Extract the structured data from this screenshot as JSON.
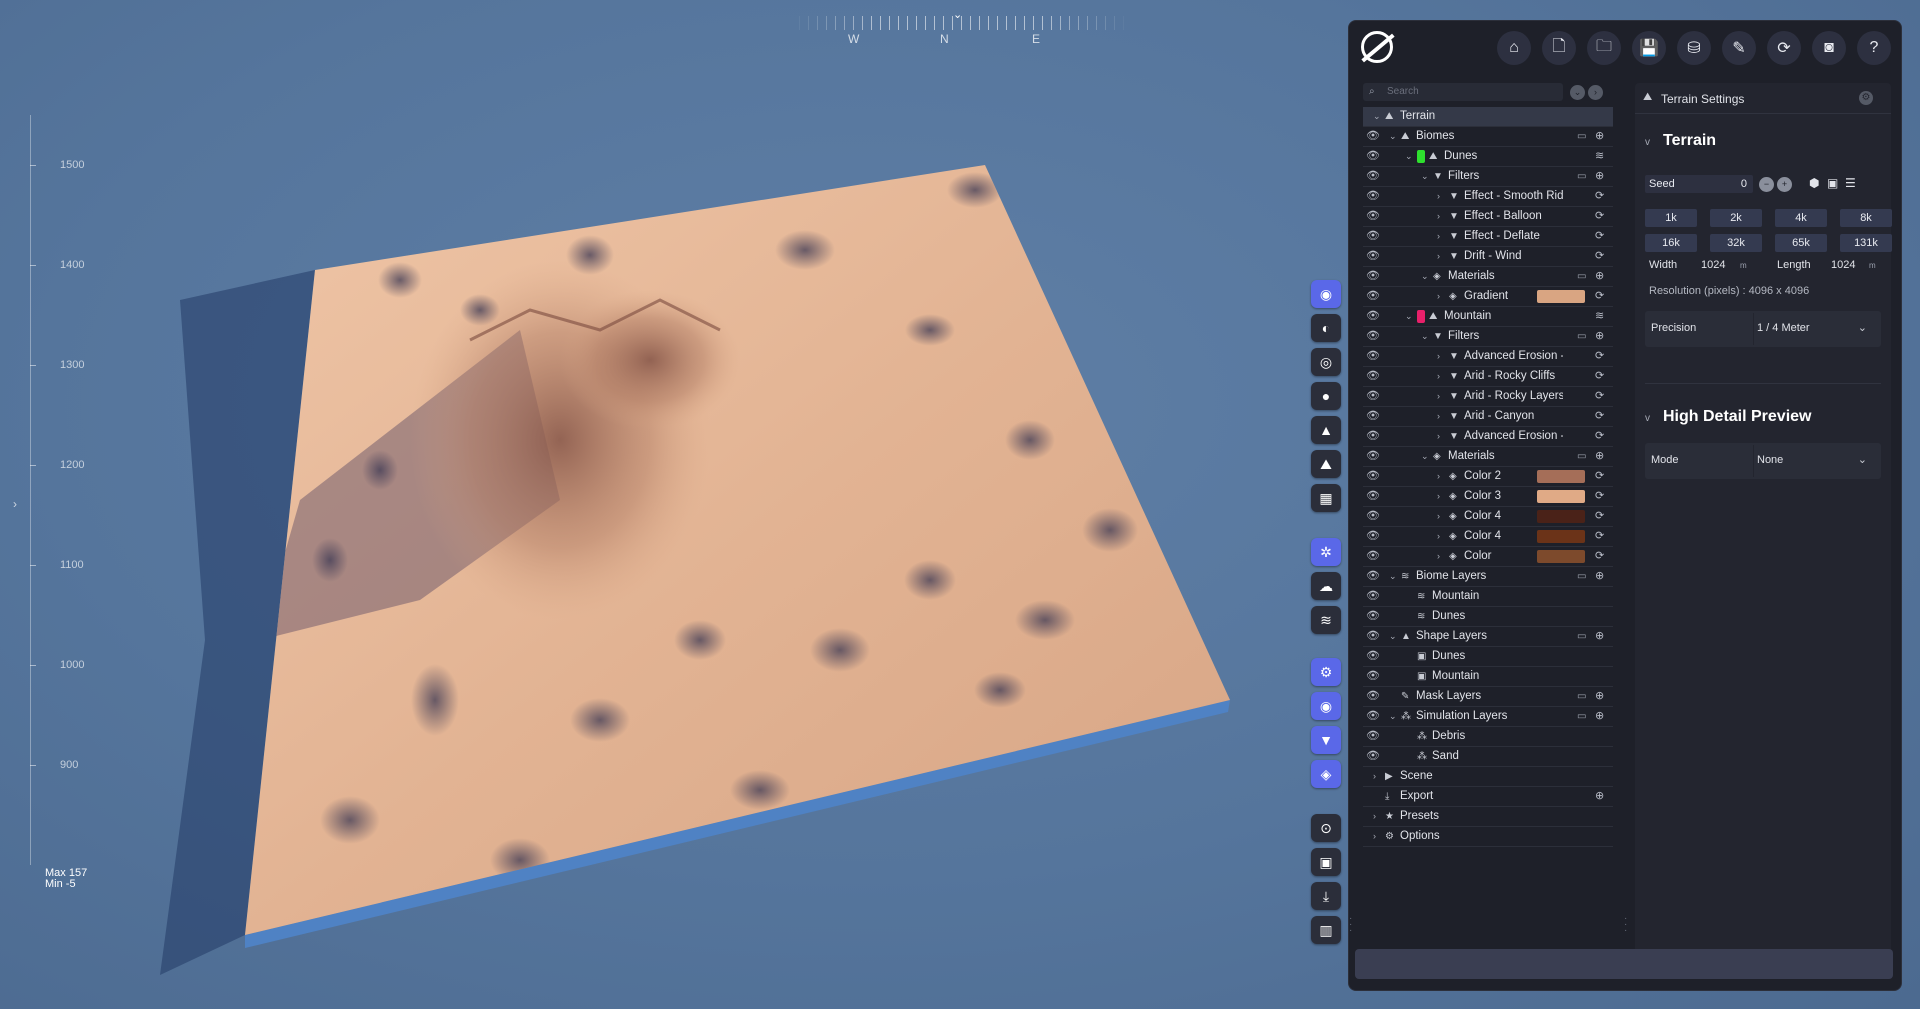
{
  "viewport": {
    "compass": [
      "W",
      "N",
      "E"
    ],
    "ruler_marks": [
      "1500",
      "1400",
      "1300",
      "1200",
      "1100",
      "1000",
      "900"
    ],
    "max_label": "Max 157",
    "min_label": "Min -5",
    "colors": {
      "sand": "#e4b898",
      "sky": "#55759c",
      "base": "#4f82c4"
    }
  },
  "toolbar": {
    "buttons": [
      {
        "name": "home-button",
        "icon": "⌂"
      },
      {
        "name": "new-file-button",
        "icon": "🗋"
      },
      {
        "name": "open-folder-button",
        "icon": "🗀"
      },
      {
        "name": "save-button",
        "icon": "💾"
      },
      {
        "name": "save-as-button",
        "icon": "⛁"
      },
      {
        "name": "edit-button",
        "icon": "✎"
      },
      {
        "name": "refresh-button",
        "icon": "⟳"
      },
      {
        "name": "screenshot-button",
        "icon": "◙"
      },
      {
        "name": "help-button",
        "icon": "?"
      }
    ]
  },
  "tools": [
    {
      "icon": "◉",
      "blue": true
    },
    {
      "icon": "◐",
      "blue": false
    },
    {
      "icon": "◎",
      "blue": false
    },
    {
      "icon": "●",
      "blue": false
    },
    {
      "icon": "▲",
      "blue": false
    },
    {
      "icon": "⛰",
      "blue": false
    },
    {
      "icon": "▦",
      "blue": false
    },
    {
      "icon": "✲",
      "blue": true
    },
    {
      "icon": "☁",
      "blue": false
    },
    {
      "icon": "≋",
      "blue": false
    },
    {
      "icon": "⚙",
      "blue": true
    },
    {
      "icon": "◉",
      "blue": true
    },
    {
      "icon": "▼",
      "blue": true
    },
    {
      "icon": "◈",
      "blue": true
    },
    {
      "icon": "⊙",
      "blue": false
    },
    {
      "icon": "▣",
      "blue": false
    },
    {
      "icon": "⤓",
      "blue": false
    },
    {
      "icon": "▥",
      "blue": false
    }
  ],
  "tree": {
    "search_placeholder": "Search",
    "rows": [
      {
        "label": "Terrain",
        "depth": 0,
        "chev": "v",
        "icon": "⛰",
        "eye": false,
        "sel": true
      },
      {
        "label": "Biomes",
        "depth": 1,
        "chev": "v",
        "icon": "⛰",
        "eye": true,
        "r1": "▭",
        "r2": "⊕"
      },
      {
        "label": "Dunes",
        "depth": 2,
        "chev": "v",
        "icon": "⛰",
        "eye": true,
        "tag": "#2ee02e",
        "r2": "≋"
      },
      {
        "label": "Filters",
        "depth": 3,
        "chev": "v",
        "icon": "▼",
        "eye": true,
        "r1": "▭",
        "r2": "⊕"
      },
      {
        "label": "Effect - Smooth Ridge",
        "depth": 4,
        "chev": ">",
        "icon": "▼",
        "eye": true,
        "r2": "⟳"
      },
      {
        "label": "Effect - Balloon",
        "depth": 4,
        "chev": ">",
        "icon": "▼",
        "eye": true,
        "r2": "⟳"
      },
      {
        "label": "Effect - Deflate",
        "depth": 4,
        "chev": ">",
        "icon": "▼",
        "eye": true,
        "r2": "⟳"
      },
      {
        "label": "Drift - Wind",
        "depth": 4,
        "chev": ">",
        "icon": "▼",
        "eye": true,
        "r2": "⟳"
      },
      {
        "label": "Materials",
        "depth": 3,
        "chev": "v",
        "icon": "◈",
        "eye": true,
        "r1": "▭",
        "r2": "⊕"
      },
      {
        "label": "Gradient",
        "depth": 4,
        "chev": ">",
        "icon": "◈",
        "eye": true,
        "swatch": "#d9a582",
        "r2": "⟳"
      },
      {
        "label": "Mountain",
        "depth": 2,
        "chev": "v",
        "icon": "⛰",
        "eye": true,
        "tag": "#e8206a",
        "r2": "≋"
      },
      {
        "label": "Filters",
        "depth": 3,
        "chev": "v",
        "icon": "▼",
        "eye": true,
        "r1": "▭",
        "r2": "⊕"
      },
      {
        "label": "Advanced Erosion - W",
        "depth": 4,
        "chev": ">",
        "icon": "▼",
        "eye": true,
        "r2": "⟳"
      },
      {
        "label": "Arid - Rocky Cliffs",
        "depth": 4,
        "chev": ">",
        "icon": "▼",
        "eye": true,
        "r2": "⟳"
      },
      {
        "label": "Arid - Rocky Layers",
        "depth": 4,
        "chev": ">",
        "icon": "▼",
        "eye": true,
        "r2": "⟳"
      },
      {
        "label": "Arid - Canyon",
        "depth": 4,
        "chev": ">",
        "icon": "▼",
        "eye": true,
        "r2": "⟳"
      },
      {
        "label": "Advanced Erosion - Sr",
        "depth": 4,
        "chev": ">",
        "icon": "▼",
        "eye": true,
        "r2": "⟳"
      },
      {
        "label": "Materials",
        "depth": 3,
        "chev": "v",
        "icon": "◈",
        "eye": true,
        "r1": "▭",
        "r2": "⊕"
      },
      {
        "label": "Color 2",
        "depth": 4,
        "chev": ">",
        "icon": "◈",
        "eye": true,
        "swatch": "#a56e58",
        "r2": "⟳"
      },
      {
        "label": "Color 3",
        "depth": 4,
        "chev": ">",
        "icon": "◈",
        "eye": true,
        "swatch": "#e0aa86",
        "r2": "⟳"
      },
      {
        "label": "Color 4",
        "depth": 4,
        "chev": ">",
        "icon": "◈",
        "eye": true,
        "swatch": "#4a2218",
        "r2": "⟳"
      },
      {
        "label": "Color 4",
        "depth": 4,
        "chev": ">",
        "icon": "◈",
        "eye": true,
        "swatch": "#6b3318",
        "r2": "⟳"
      },
      {
        "label": "Color",
        "depth": 4,
        "chev": ">",
        "icon": "◈",
        "eye": true,
        "swatch": "#7d4a2c",
        "r2": "⟳"
      },
      {
        "label": "Biome Layers",
        "depth": 1,
        "chev": "v",
        "icon": "≋",
        "eye": true,
        "r1": "▭",
        "r2": "⊕"
      },
      {
        "label": "Mountain",
        "depth": 2,
        "chev": "",
        "icon": "≋",
        "eye": true
      },
      {
        "label": "Dunes",
        "depth": 2,
        "chev": "",
        "icon": "≋",
        "eye": true
      },
      {
        "label": "Shape Layers",
        "depth": 1,
        "chev": "v",
        "icon": "▲",
        "eye": true,
        "r1": "▭",
        "r2": "⊕"
      },
      {
        "label": "Dunes",
        "depth": 2,
        "chev": "",
        "icon": "▣",
        "eye": true
      },
      {
        "label": "Mountain",
        "depth": 2,
        "chev": "",
        "icon": "▣",
        "eye": true
      },
      {
        "label": "Mask Layers",
        "depth": 1,
        "chev": "",
        "icon": "✎",
        "eye": true,
        "r1": "▭",
        "r2": "⊕"
      },
      {
        "label": "Simulation Layers",
        "depth": 1,
        "chev": "v",
        "icon": "⁂",
        "eye": true,
        "r1": "▭",
        "r2": "⊕"
      },
      {
        "label": "Debris",
        "depth": 2,
        "chev": "",
        "icon": "⁂",
        "eye": true
      },
      {
        "label": "Sand",
        "depth": 2,
        "chev": "",
        "icon": "⁂",
        "eye": true
      },
      {
        "label": "Scene",
        "depth": 0,
        "chev": ">",
        "icon": "▶",
        "eye": false
      },
      {
        "label": "Export",
        "depth": 0,
        "chev": "",
        "icon": "⤓",
        "eye": false,
        "r2": "⊕"
      },
      {
        "label": "Presets",
        "depth": 0,
        "chev": ">",
        "icon": "★",
        "eye": false
      },
      {
        "label": "Options",
        "depth": 0,
        "chev": ">",
        "icon": "⚙",
        "eye": false
      }
    ]
  },
  "settings": {
    "header": "Terrain Settings",
    "terrain_title": "Terrain",
    "seed_label": "Seed",
    "seed_value": "0",
    "resolution_buttons": [
      "1k",
      "2k",
      "4k",
      "8k",
      "16k",
      "32k",
      "65k",
      "131k"
    ],
    "width_label": "Width",
    "width_value": "1024",
    "length_label": "Length",
    "length_value": "1024",
    "unit": "m",
    "resolution_text": "Resolution (pixels)  :  4096 x 4096",
    "precision_label": "Precision",
    "precision_value": "1 / 4 Meter",
    "hdp_title": "High Detail Preview",
    "mode_label": "Mode",
    "mode_value": "None"
  }
}
